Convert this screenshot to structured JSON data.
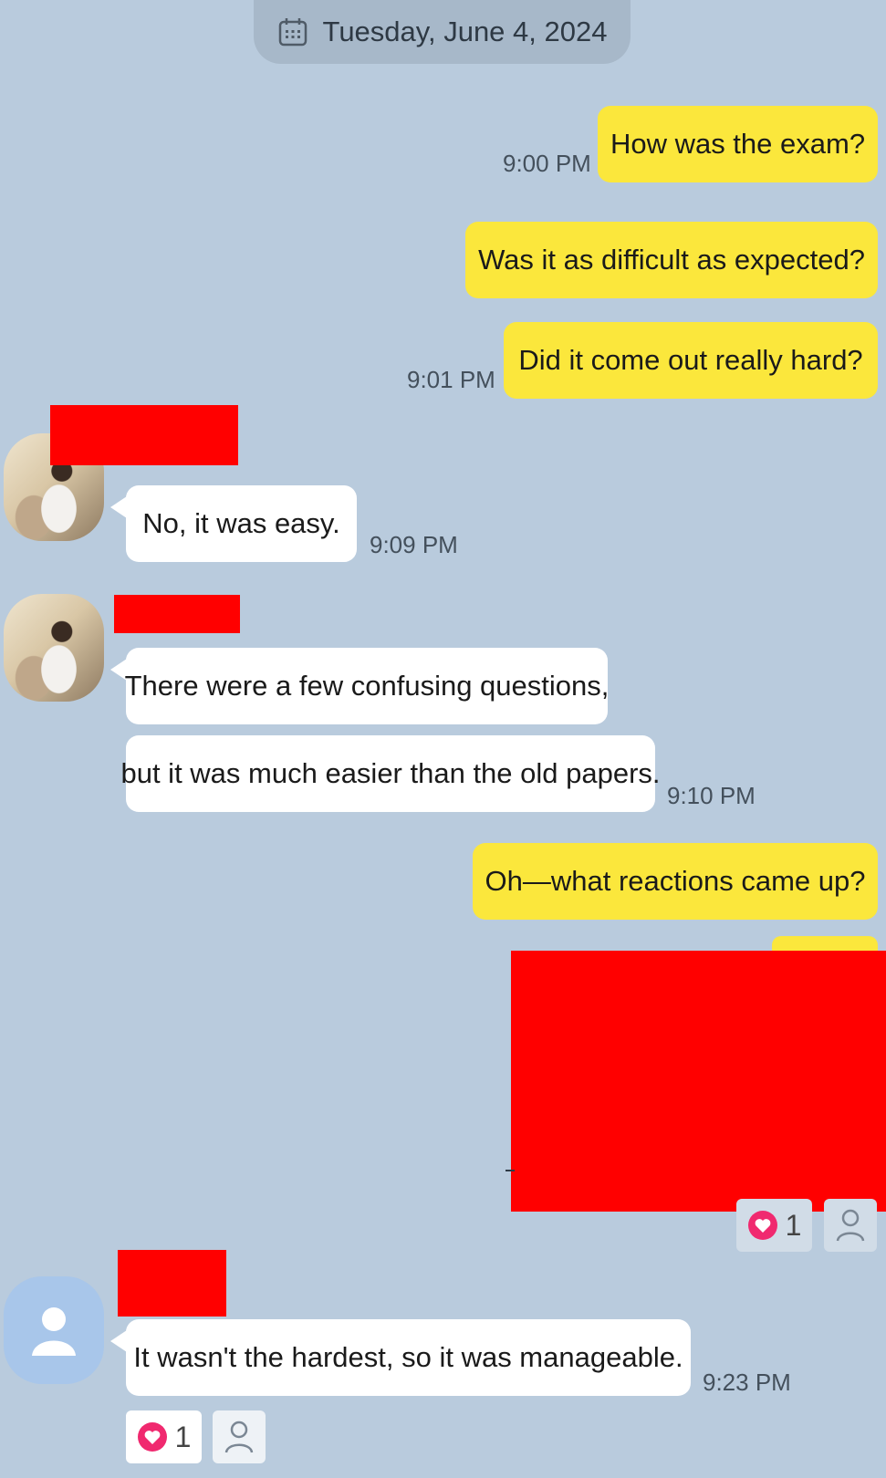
{
  "date_header": {
    "label": "Tuesday, June 4, 2024",
    "icon": "calendar-icon"
  },
  "messages": [
    {
      "id": "m1",
      "side": "sent",
      "text": "How was the exam?",
      "time": "9:00 PM"
    },
    {
      "id": "m2",
      "side": "sent",
      "text": "Was it as difficult as expected?",
      "time": ""
    },
    {
      "id": "m3",
      "side": "sent",
      "text": "Did it come out really hard?",
      "time": "9:01 PM"
    },
    {
      "id": "m4",
      "side": "received",
      "text": "No, it was easy.",
      "time": "9:09 PM"
    },
    {
      "id": "m5",
      "side": "received",
      "text": "There were a few confusing questions,",
      "time": ""
    },
    {
      "id": "m6",
      "side": "received",
      "text": "but it was much easier than the old papers.",
      "time": "9:10 PM"
    },
    {
      "id": "m7",
      "side": "sent",
      "text": "Oh—what reactions came up?",
      "time": ""
    },
    {
      "id": "m8",
      "side": "received",
      "text": "It wasn't the hardest, so it was manageable.",
      "time": "9:23 PM"
    }
  ],
  "reactions": {
    "sent_block": {
      "count": "1",
      "icon": "heart-icon"
    },
    "last_message": {
      "count": "1",
      "icon": "heart-icon"
    }
  },
  "colors": {
    "background": "#b9cbdd",
    "sent_bubble": "#fbe73c",
    "received_bubble": "#ffffff",
    "redaction": "#ff0000",
    "heart": "#f0296f"
  }
}
